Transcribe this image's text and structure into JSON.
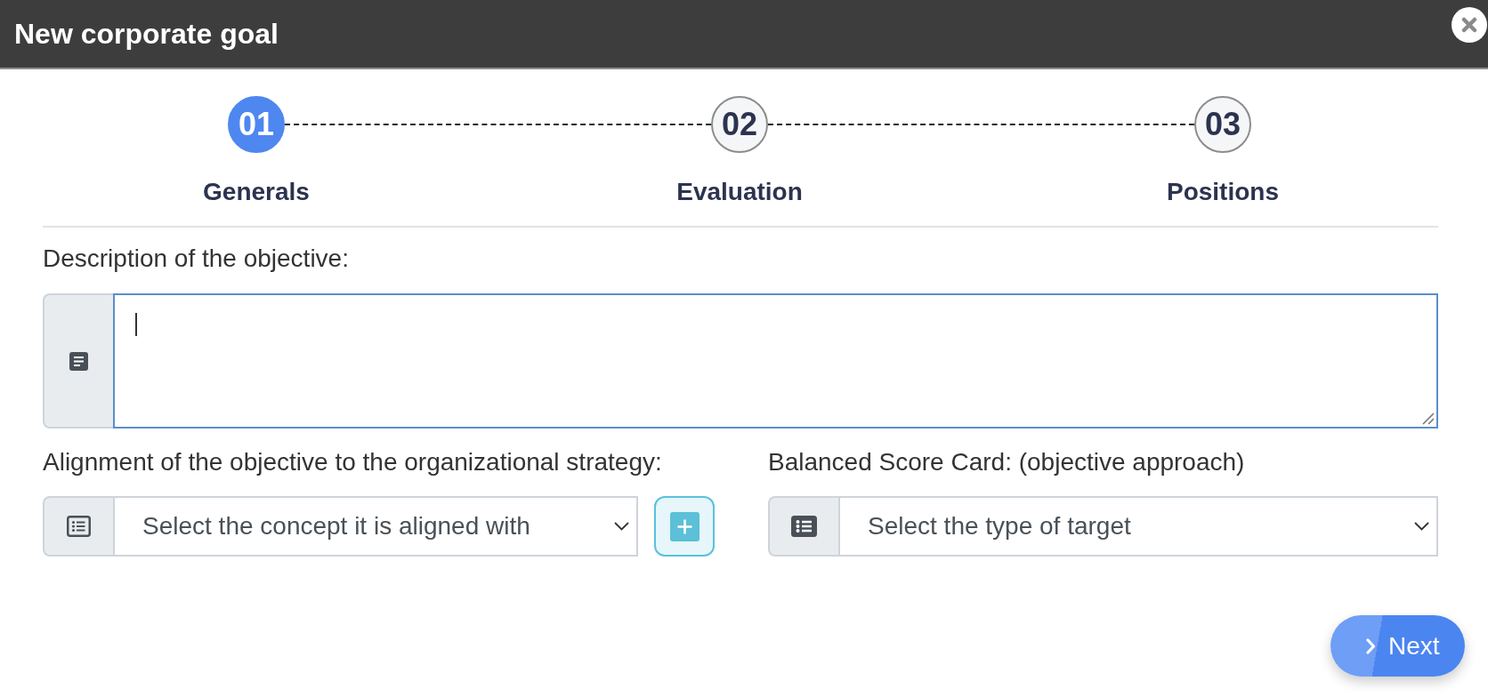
{
  "window": {
    "title": "New corporate goal"
  },
  "steps": [
    {
      "number": "01",
      "label": "Generals",
      "selected": true
    },
    {
      "number": "02",
      "label": "Evaluation",
      "selected": false
    },
    {
      "number": "03",
      "label": "Positions",
      "selected": false
    }
  ],
  "description": {
    "label": "Description of the objective:",
    "focused": true
  },
  "alignment": {
    "label": "Alignment of the objective to the organizational strategy:",
    "placeholder": "Select the concept it is aligned with"
  },
  "balanced_score_card": {
    "label": "Balanced Score Card: (objective approach)",
    "placeholder": "Select the type of target"
  },
  "next_button": {
    "label": "Next"
  }
}
